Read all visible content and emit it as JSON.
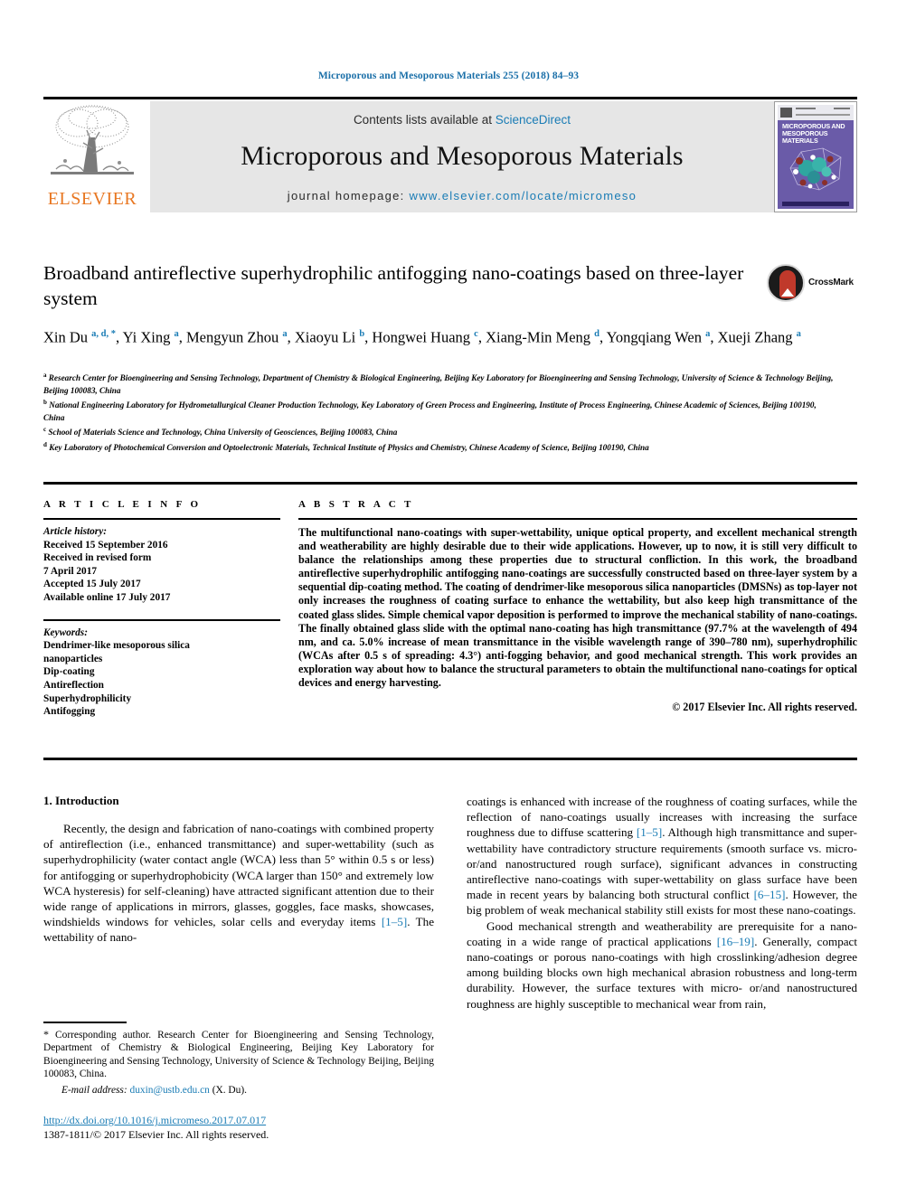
{
  "running_head": "Microporous and Mesoporous Materials 255 (2018) 84–93",
  "masthead": {
    "contents_prefix": "Contents lists available at ",
    "sciencedirect": "ScienceDirect",
    "journal_title": "Microporous and Mesoporous Materials",
    "homepage_prefix": "journal homepage: ",
    "homepage_url": "www.elsevier.com/locate/micromeso",
    "publisher_logo_text": "ELSEVIER",
    "cover_title_line1": "MICROPOROUS AND",
    "cover_title_line2": "MESOPOROUS MATERIALS",
    "accent_link_color": "#1a7cb5",
    "panel_bg_color": "#e6e6e6",
    "elsevier_orange": "#E87722",
    "cover_purple": "#6a5ba8"
  },
  "crossmark": {
    "label": "CrossMark"
  },
  "article": {
    "title": "Broadband antireflective superhydrophilic antifogging nano-coatings based on three-layer system",
    "authors_html": "Xin Du <sup>a, d, *</sup>, Yi Xing <sup>a</sup>, Mengyun Zhou <sup>a</sup>, Xiaoyu Li <sup>b</sup>, Hongwei Huang <sup>c</sup>, Xiang-Min Meng <sup>d</sup>, Yongqiang Wen <sup>a</sup>, Xueji Zhang <sup>a</sup>",
    "affiliations": [
      {
        "mark": "a",
        "text": "Research Center for Bioengineering and Sensing Technology, Department of Chemistry & Biological Engineering, Beijing Key Laboratory for Bioengineering and Sensing Technology, University of Science & Technology Beijing, Beijing 100083, China"
      },
      {
        "mark": "b",
        "text": "National Engineering Laboratory for Hydrometallurgical Cleaner Production Technology, Key Laboratory of Green Process and Engineering, Institute of Process Engineering, Chinese Academic of Sciences, Beijing 100190, China"
      },
      {
        "mark": "c",
        "text": "School of Materials Science and Technology, China University of Geosciences, Beijing 100083, China"
      },
      {
        "mark": "d",
        "text": "Key Laboratory of Photochemical Conversion and Optoelectronic Materials, Technical Institute of Physics and Chemistry, Chinese Academy of Science, Beijing 100190, China"
      }
    ]
  },
  "article_info": {
    "heading": "A R T I C L E   I N F O",
    "history_label": "Article history:",
    "history": [
      "Received 15 September 2016",
      "Received in revised form",
      "7 April 2017",
      "Accepted 15 July 2017",
      "Available online 17 July 2017"
    ],
    "keywords_label": "Keywords:",
    "keywords": [
      "Dendrimer-like mesoporous silica",
      "nanoparticles",
      "Dip-coating",
      "Antireflection",
      "Superhydrophilicity",
      "Antifogging"
    ]
  },
  "abstract": {
    "heading": "A B S T R A C T",
    "text": "The multifunctional nano-coatings with super-wettability, unique optical property, and excellent mechanical strength and weatherability are highly desirable due to their wide applications. However, up to now, it is still very difficult to balance the relationships among these properties due to structural confliction. In this work, the broadband antireflective superhydrophilic antifogging nano-coatings are successfully constructed based on three-layer system by a sequential dip-coating method. The coating of dendrimer-like mesoporous silica nanoparticles (DMSNs) as top-layer not only increases the roughness of coating surface to enhance the wettability, but also keep high transmittance of the coated glass slides. Simple chemical vapor deposition is performed to improve the mechanical stability of nano-coatings. The finally obtained glass slide with the optimal nano-coating has high transmittance (97.7% at the wavelength of 494 nm, and ca. 5.0% increase of mean transmittance in the visible wavelength range of 390–780 nm), superhydrophilic (WCAs after 0.5 s of spreading: 4.3°) anti-fogging behavior, and good mechanical strength. This work provides an exploration way about how to balance the structural parameters to obtain the multifunctional nano-coatings for optical devices and energy harvesting.",
    "copyright": "© 2017 Elsevier Inc. All rights reserved."
  },
  "body": {
    "section_title": "1. Introduction",
    "left_paragraph_html": "Recently, the design and fabrication of nano-coatings with combined property of antireflection (i.e., enhanced transmittance) and super-wettability (such as superhydrophilicity (water contact angle (WCA) less than 5° within 0.5 s or less) for antifogging or superhydrophobicity (WCA larger than 150° and extremely low WCA hysteresis) for self-cleaning) have attracted significant attention due to their wide range of applications in mirrors, glasses, goggles, face masks, showcases, windshields windows for vehicles, solar cells and everyday items <span class=\"ref\">[1–5]</span>. The wettability of nano-",
    "right_paragraph_1_html": "coatings is enhanced with increase of the roughness of coating surfaces, while the reflection of nano-coatings usually increases with increasing the surface roughness due to diffuse scattering <span class=\"ref\">[1–5]</span>. Although high transmittance and super-wettability have contradictory structure requirements (smooth surface vs. micro- or/and nanostructured rough surface), significant advances in constructing antireflective nano-coatings with super-wettability on glass surface have been made in recent years by balancing both structural conflict <span class=\"ref\">[6–15]</span>. However, the big problem of weak mechanical stability still exists for most these nano-coatings.",
    "right_paragraph_2_html": "Good mechanical strength and weatherability are prerequisite for a nano-coating in a wide range of practical applications <span class=\"ref\">[16–19]</span>. Generally, compact nano-coatings or porous nano-coatings with high crosslinking/adhesion degree among building blocks own high mechanical abrasion robustness and long-term durability. However, the surface textures with micro- or/and nanostructured roughness are highly susceptible to mechanical wear from rain,"
  },
  "footnote": {
    "corresponding_html": "<span class=\"ast\">*</span> Corresponding author. Research Center for Bioengineering and Sensing Technology, Department of Chemistry &amp; Biological Engineering, Beijing Key Laboratory for Bioengineering and Sensing Technology, University of Science &amp; Technology Beijing, Beijing 100083, China.",
    "email_label": "E-mail address:",
    "email": "duxin@ustb.edu.cn",
    "email_suffix": "(X. Du)."
  },
  "footer": {
    "doi": "http://dx.doi.org/10.1016/j.micromeso.2017.07.017",
    "issn_line": "1387-1811/© 2017 Elsevier Inc. All rights reserved."
  }
}
